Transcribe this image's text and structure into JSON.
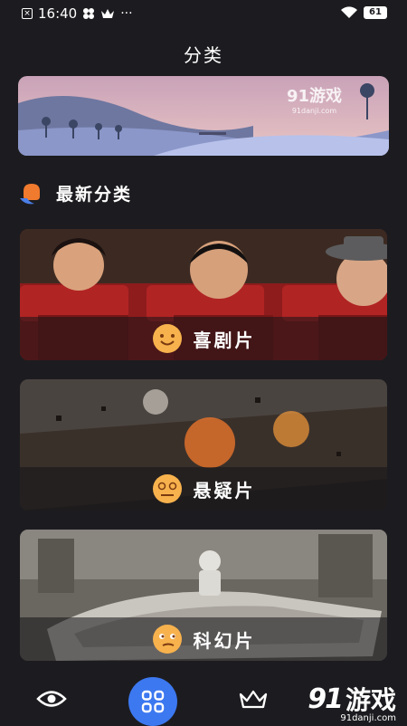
{
  "status": {
    "time": "16:40",
    "dots": "···",
    "battery": "61"
  },
  "header": {
    "title": "分类"
  },
  "banner": {
    "brand_text": "91游戏",
    "brand_url": "91danji.com"
  },
  "section": {
    "label": "最新分类"
  },
  "categories": [
    {
      "label": "喜剧片",
      "emoji": "happy-face-icon"
    },
    {
      "label": "悬疑片",
      "emoji": "dizzy-face-icon"
    },
    {
      "label": "科幻片",
      "emoji": "smirk-face-icon"
    }
  ],
  "nav": {
    "items": [
      {
        "icon": "eye-icon",
        "active": false
      },
      {
        "icon": "grid-icon",
        "active": true
      },
      {
        "icon": "crown-icon",
        "active": false
      }
    ]
  },
  "watermark": {
    "text": "游戏",
    "num": "91",
    "url": "91danji.com"
  },
  "colors": {
    "background": "#1c1c20",
    "accent": "#3c78f0",
    "emoji": "#f7b24d",
    "section_icon": "#f07a2e"
  }
}
